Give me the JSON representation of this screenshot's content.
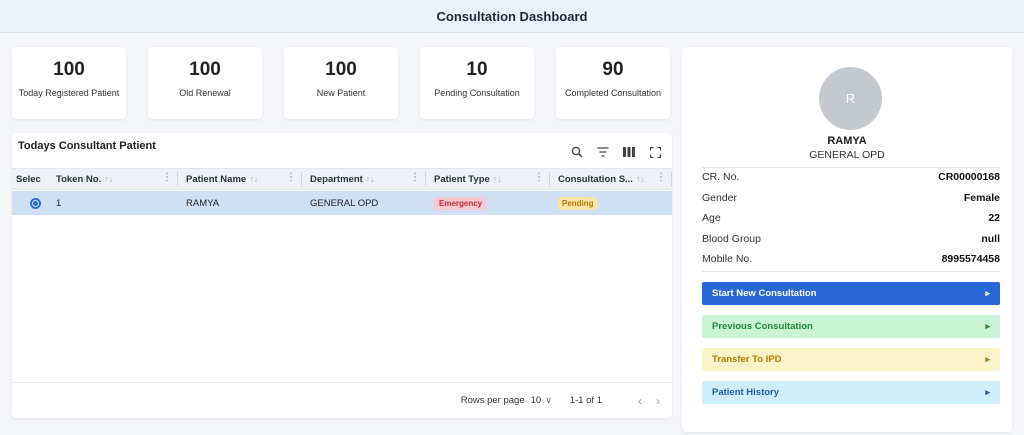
{
  "header": {
    "title": "Consultation Dashboard"
  },
  "stats": [
    {
      "value": "100",
      "label": "Today Registered Patient"
    },
    {
      "value": "100",
      "label": "Old Renewal"
    },
    {
      "value": "100",
      "label": "New Patient"
    },
    {
      "value": "10",
      "label": "Pending Consultation"
    },
    {
      "value": "90",
      "label": "Completed Consultation"
    }
  ],
  "table": {
    "title": "Todays Consultant Patient",
    "tools": [
      "search-icon",
      "filter-icon",
      "columns-icon",
      "fullscreen-icon"
    ],
    "columns": [
      "Selec",
      "Token No.",
      "Patient Name",
      "Department",
      "Patient Type",
      "Consultation S..."
    ],
    "rows": [
      {
        "token": "1",
        "name": "RAMYA",
        "department": "GENERAL OPD",
        "type": "Emergency",
        "status": "Pending"
      }
    ],
    "footer": {
      "rows_per_page_label": "Rows per page",
      "rows_per_page_value": "10",
      "range": "1-1 of 1"
    }
  },
  "patient": {
    "avatar_initial": "R",
    "name": "RAMYA",
    "department": "GENERAL OPD",
    "details": [
      {
        "label": "CR. No.",
        "value": "CR00000168"
      },
      {
        "label": "Gender",
        "value": "Female"
      },
      {
        "label": "Age",
        "value": "22"
      },
      {
        "label": "Blood Group",
        "value": "null"
      },
      {
        "label": "Mobile No.",
        "value": "8995574458"
      }
    ]
  },
  "actions": {
    "start": "Start New Consultation",
    "previous": "Previous Consultation",
    "transfer": "Transfer To IPD",
    "history": "Patient History"
  },
  "colors": {
    "accent": "#2867d6",
    "selected_row": "#cfe0f5",
    "emergency": "#c4283b",
    "pending": "#b07a00"
  }
}
